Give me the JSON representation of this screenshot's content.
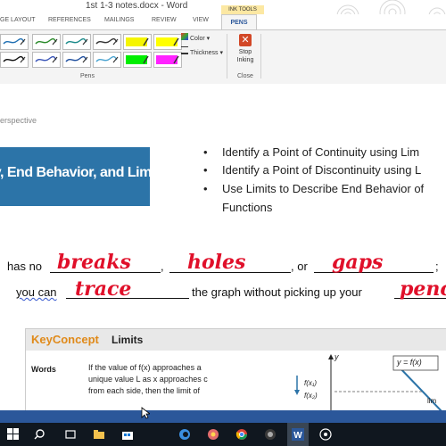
{
  "window": {
    "title": "1st 1-3 notes.docx - Word"
  },
  "ribbon": {
    "contextual_group": "INK TOOLS",
    "tabs": [
      {
        "label": "GE LAYOUT"
      },
      {
        "label": "REFERENCES"
      },
      {
        "label": "MAILINGS"
      },
      {
        "label": "REVIEW"
      },
      {
        "label": "VIEW"
      }
    ],
    "active_tab": "PENS",
    "color_label": "Color",
    "thickness_label": "Thickness",
    "stop_inking_label": "Stop Inking",
    "pens_group_label": "Pens",
    "close_group_label": "Close",
    "pen_colors": [
      "#1f6fb2",
      "#2a8a2a",
      "#1b8a8a",
      "#333333",
      "#f5f500",
      "#ffff00",
      "#111111",
      "#3a55b8",
      "#1f4f9e",
      "#4aa3d0",
      "#00ee00",
      "#ff22ff"
    ]
  },
  "document": {
    "subtitle_fragment": "erspective",
    "banner_text": "ity, End Behavior, and Limits",
    "objectives": [
      "Identify a Point of Continuity using Lim",
      "Identify a Point of Discontinuity using L",
      "Use Limits to Describe End Behavior of",
      "Functions"
    ],
    "line1": {
      "prefix": "has no",
      "sep1": ",",
      "sep2": ", or",
      "end": ";"
    },
    "line2": {
      "prefix": "you can",
      "middle": "the graph without picking up your"
    },
    "ink_words": [
      "breaks",
      "holes",
      "gaps",
      "trace",
      "penc"
    ],
    "key_concept": {
      "key": "KeyConcept",
      "title": "Limits",
      "words_label": "Words",
      "body": [
        "If the value of f(x) approaches a",
        "unique value L as x approaches c",
        "from each side, then the limit of"
      ],
      "graph_label": "y = f(x)",
      "graph_y_axis": "y",
      "graph_tick_1": "f(x₁)",
      "graph_tick_2": "f(x₂)",
      "graph_fragment": "lim"
    }
  }
}
